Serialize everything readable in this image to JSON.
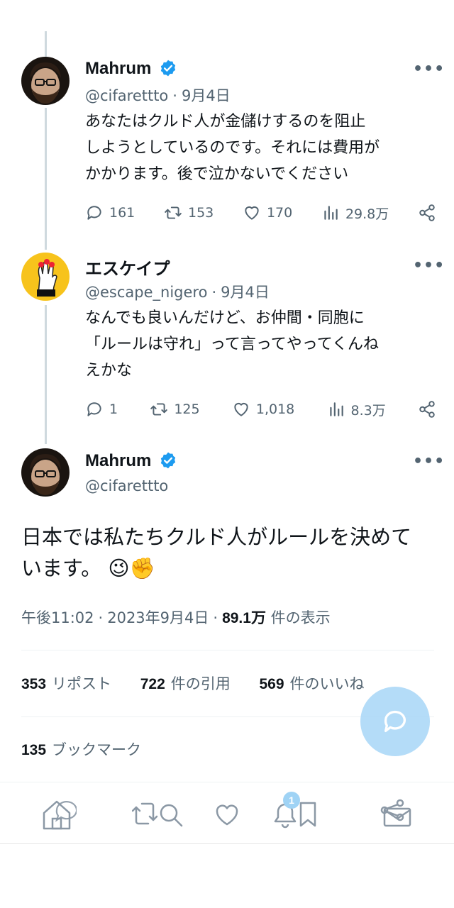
{
  "tweets": [
    {
      "name": "Mahrum",
      "handle": "@cifarettto",
      "date": "9月4日",
      "more": "•••",
      "text_lines": [
        "あなたはクルド人が金儲けするのを阻止",
        "しようとしているのです。それには費用が",
        "かかります。後で泣かないでください"
      ],
      "replies": "161",
      "retweets": "153",
      "likes": "170",
      "views": "29.8万"
    },
    {
      "name": "エスケイプ",
      "handle": "@escape_nigero",
      "date": "9月4日",
      "more": "•••",
      "text_lines": [
        "なんでも良いんだけど、お仲間・同胞に",
        "「ルールは守れ」って言ってやってくんね",
        "えかな"
      ],
      "replies": "1",
      "retweets": "125",
      "likes": "1,018",
      "views": "8.3万"
    }
  ],
  "main": {
    "name": "Mahrum",
    "handle": "@cifarettto",
    "more": "•••",
    "text_line1": "日本では私たちクルド人がルールを決めて",
    "text_line2": "います。",
    "emoji": "😉✊",
    "time": "午後11:02",
    "date": "2023年9月4日",
    "views_count": "89.1万",
    "views_label": "件の表示",
    "reposts_count": "353",
    "reposts_label": "リポスト",
    "quotes_count": "722",
    "quotes_label": "件の引用",
    "likes_count": "569",
    "likes_label": "件のいいね",
    "bookmarks_count": "135",
    "bookmarks_label": "ブックマーク"
  },
  "separator": "·",
  "nav": {
    "notification_badge": "1"
  },
  "colors": {
    "verified": "#1d9bf0",
    "muted": "#536471",
    "fab": "#a8d6f7"
  }
}
